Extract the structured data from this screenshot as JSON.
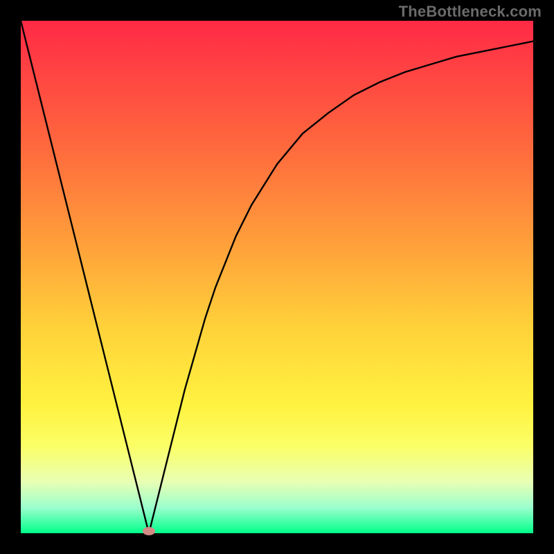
{
  "watermark": "TheBottleneck.com",
  "chart_data": {
    "type": "line",
    "title": "",
    "xlabel": "",
    "ylabel": "",
    "xlim": [
      0,
      100
    ],
    "ylim": [
      0,
      100
    ],
    "grid": false,
    "legend": false,
    "x": [
      0,
      2,
      4,
      6,
      8,
      10,
      12,
      14,
      16,
      18,
      20,
      22,
      24,
      25,
      26,
      28,
      30,
      32,
      34,
      36,
      38,
      40,
      42,
      45,
      50,
      55,
      60,
      65,
      70,
      75,
      80,
      85,
      90,
      95,
      100
    ],
    "values": [
      100,
      92,
      84,
      76,
      68,
      60,
      52,
      44,
      36,
      28,
      20,
      12,
      4,
      0,
      4,
      12,
      20,
      28,
      35,
      42,
      48,
      53,
      58,
      64,
      72,
      78,
      82,
      85.5,
      88,
      90,
      91.5,
      93,
      94,
      95,
      96
    ],
    "marker": {
      "x": 25,
      "y": 0
    }
  },
  "background_gradient": {
    "type": "vertical",
    "stops": [
      {
        "pos": 0,
        "color": "#ff2a46"
      },
      {
        "pos": 25,
        "color": "#ff6a3d"
      },
      {
        "pos": 45,
        "color": "#ffa43a"
      },
      {
        "pos": 60,
        "color": "#ffd23a"
      },
      {
        "pos": 75,
        "color": "#fff240"
      },
      {
        "pos": 83,
        "color": "#fbff66"
      },
      {
        "pos": 90,
        "color": "#e8ffb4"
      },
      {
        "pos": 95,
        "color": "#9bffcd"
      },
      {
        "pos": 100,
        "color": "#00ff8a"
      }
    ]
  }
}
